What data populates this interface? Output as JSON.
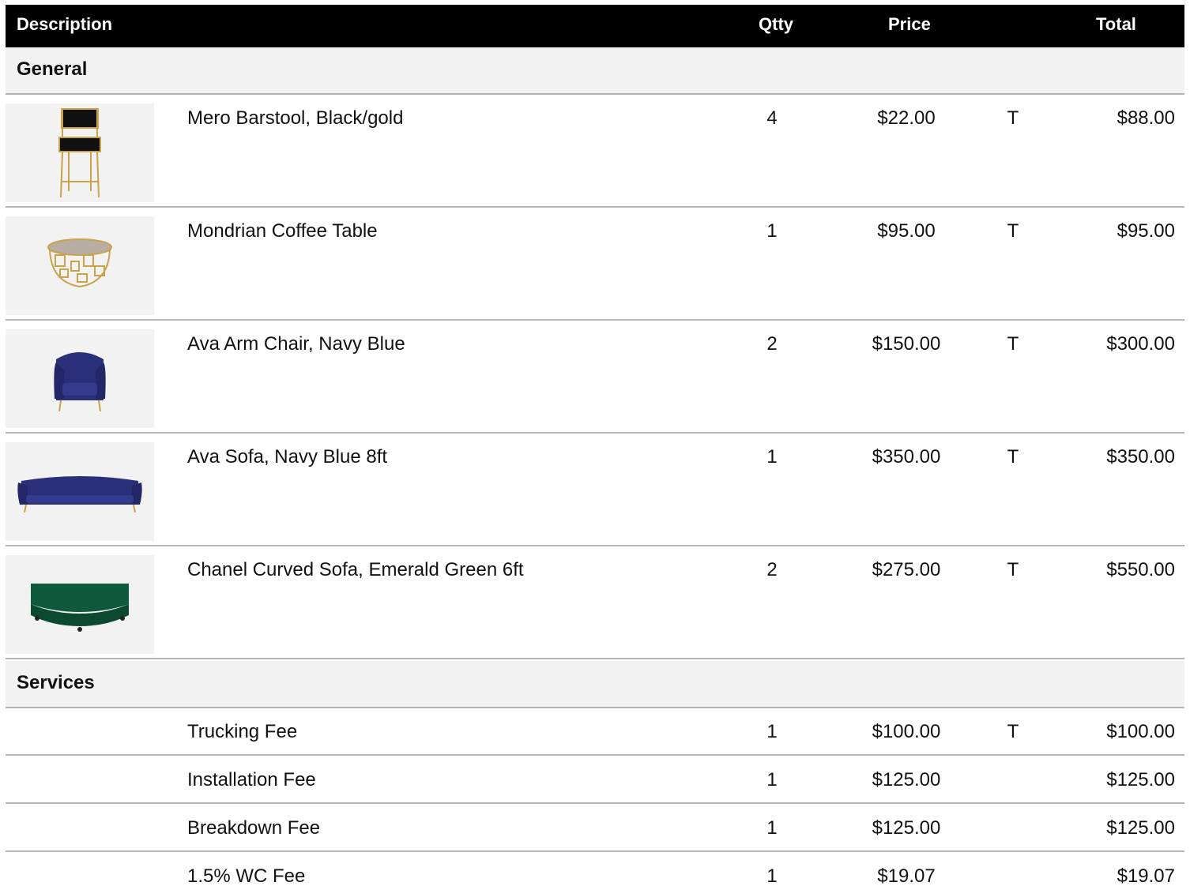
{
  "header": {
    "description": "Description",
    "qty": "Qtty",
    "price": "Price",
    "total": "Total"
  },
  "sections": {
    "general": "General",
    "services": "Services"
  },
  "general_items": [
    {
      "description": "Mero Barstool, Black/gold",
      "qty": "4",
      "price": "$22.00",
      "tax": "T",
      "total": "$88.00",
      "image_icon": "barstool-icon"
    },
    {
      "description": "Mondrian Coffee Table",
      "qty": "1",
      "price": "$95.00",
      "tax": "T",
      "total": "$95.00",
      "image_icon": "coffee-table-icon"
    },
    {
      "description": "Ava Arm Chair, Navy Blue",
      "qty": "2",
      "price": "$150.00",
      "tax": "T",
      "total": "$300.00",
      "image_icon": "armchair-icon"
    },
    {
      "description": "Ava Sofa, Navy Blue 8ft",
      "qty": "1",
      "price": "$350.00",
      "tax": "T",
      "total": "$350.00",
      "image_icon": "sofa-icon"
    },
    {
      "description": "Chanel Curved Sofa, Emerald Green 6ft",
      "qty": "2",
      "price": "$275.00",
      "tax": "T",
      "total": "$550.00",
      "image_icon": "curved-sofa-icon"
    }
  ],
  "service_items": [
    {
      "description": "Trucking Fee",
      "qty": "1",
      "price": "$100.00",
      "tax": "T",
      "total": "$100.00"
    },
    {
      "description": "Installation Fee",
      "qty": "1",
      "price": "$125.00",
      "tax": "",
      "total": "$125.00"
    },
    {
      "description": "Breakdown Fee",
      "qty": "1",
      "price": "$125.00",
      "tax": "",
      "total": "$125.00"
    },
    {
      "description": "1.5% WC Fee",
      "qty": "1",
      "price": "$19.07",
      "tax": "",
      "total": "$19.07"
    }
  ],
  "colors": {
    "header_bg": "#000000",
    "header_text": "#ffffff",
    "section_bg": "#f2f2f2",
    "divider": "#b5b5b5",
    "gold": "#c9a24a",
    "navy": "#2a2f7a",
    "emerald": "#0f5a3c"
  }
}
